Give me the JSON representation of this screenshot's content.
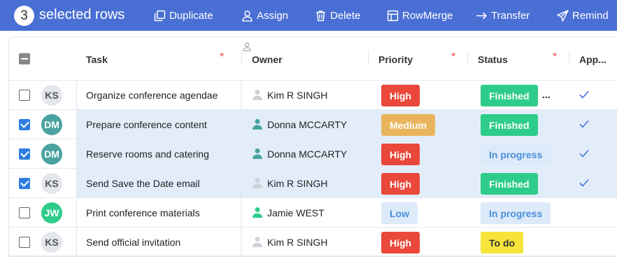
{
  "toolbar": {
    "count": "3",
    "selected_label": "selected rows",
    "actions": [
      {
        "label": "Duplicate",
        "icon": "copy-icon"
      },
      {
        "label": "Assign",
        "icon": "user-icon"
      },
      {
        "label": "Delete",
        "icon": "trash-icon"
      },
      {
        "label": "RowMerge",
        "icon": "merge-icon"
      },
      {
        "label": "Transfer",
        "icon": "arrow-right-icon"
      },
      {
        "label": "Remind",
        "icon": "send-icon"
      }
    ]
  },
  "columns": {
    "task": "Task",
    "owner": "Owner",
    "priority": "Priority",
    "status": "Status",
    "approval": "App..."
  },
  "rows": [
    {
      "selected": false,
      "initials": "KS",
      "task": "Organize conference agendae",
      "owner": "Kim R SINGH",
      "priority": "High",
      "status": "Finished",
      "approved": true,
      "more": "..."
    },
    {
      "selected": true,
      "initials": "DM",
      "task": "Prepare conference content",
      "owner": "Donna MCCARTY",
      "priority": "Medium",
      "status": "Finished",
      "approved": true,
      "more": ""
    },
    {
      "selected": true,
      "initials": "DM",
      "task": "Reserve rooms and catering",
      "owner": "Donna MCCARTY",
      "priority": "High",
      "status": "In progress",
      "approved": true,
      "more": ""
    },
    {
      "selected": true,
      "initials": "KS",
      "task": "Send Save the Date email",
      "owner": "Kim R SINGH",
      "priority": "High",
      "status": "Finished",
      "approved": true,
      "more": ""
    },
    {
      "selected": false,
      "initials": "JW",
      "task": "Print conference materials",
      "owner": "Jamie WEST",
      "priority": "Low",
      "status": "In progress",
      "approved": false,
      "more": ""
    },
    {
      "selected": false,
      "initials": "KS",
      "task": "Send official invitation",
      "owner": "Kim R SINGH",
      "priority": "High",
      "status": "To do",
      "approved": false,
      "more": ""
    }
  ],
  "colors": {
    "toolbar": "#4a6fd4",
    "high": "#e9483b",
    "medium": "#e9b55c",
    "low_bg": "#ddeaf9",
    "low_text": "#4a90d9",
    "finished": "#2ecc8a",
    "in_progress_bg": "#ddeaf9",
    "in_progress_text": "#4a90d9",
    "todo": "#f6e43a",
    "avatar_ks": "#e4e7ec",
    "avatar_dm": "#4aa3a0",
    "avatar_jw": "#2ecc8a"
  }
}
